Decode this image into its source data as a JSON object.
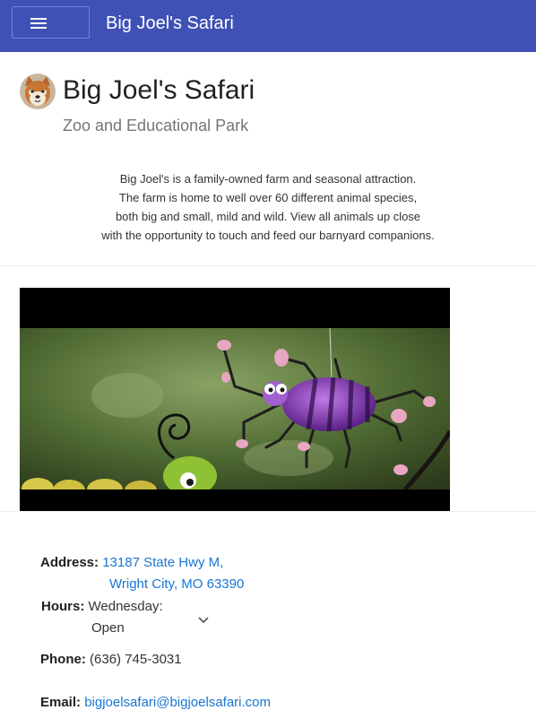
{
  "appbar": {
    "title": "Big Joel's Safari",
    "menu_icon": "hamburger-menu-icon",
    "color": "#3f51b5"
  },
  "header": {
    "title": "Big Joel's Safari",
    "subtitle": "Zoo and Educational Park",
    "avatar_icon": "shiba-dog-avatar"
  },
  "description": {
    "lines": [
      "Big Joel's is a family-owned farm and seasonal attraction.",
      "The farm is home to well over 60 different animal species,",
      "both big and small, mild and wild. View all animals up close",
      "with the opportunity to touch and feed our barnyard companions."
    ]
  },
  "media": {
    "type": "video"
  },
  "contact": {
    "address_label": "Address:",
    "address_line1": "13187 State Hwy M,",
    "address_line2": "Wright City, MO 63390",
    "hours_label": "Hours:",
    "hours_day": "Wednesday:",
    "hours_status": "Open",
    "phone_label": "Phone:",
    "phone": "(636) 745-3031",
    "email_label": "Email:",
    "email": "bigjoelsafari@bigjoelsafari.com"
  },
  "colors": {
    "accent": "#3f51b5",
    "link": "#1976d2"
  }
}
